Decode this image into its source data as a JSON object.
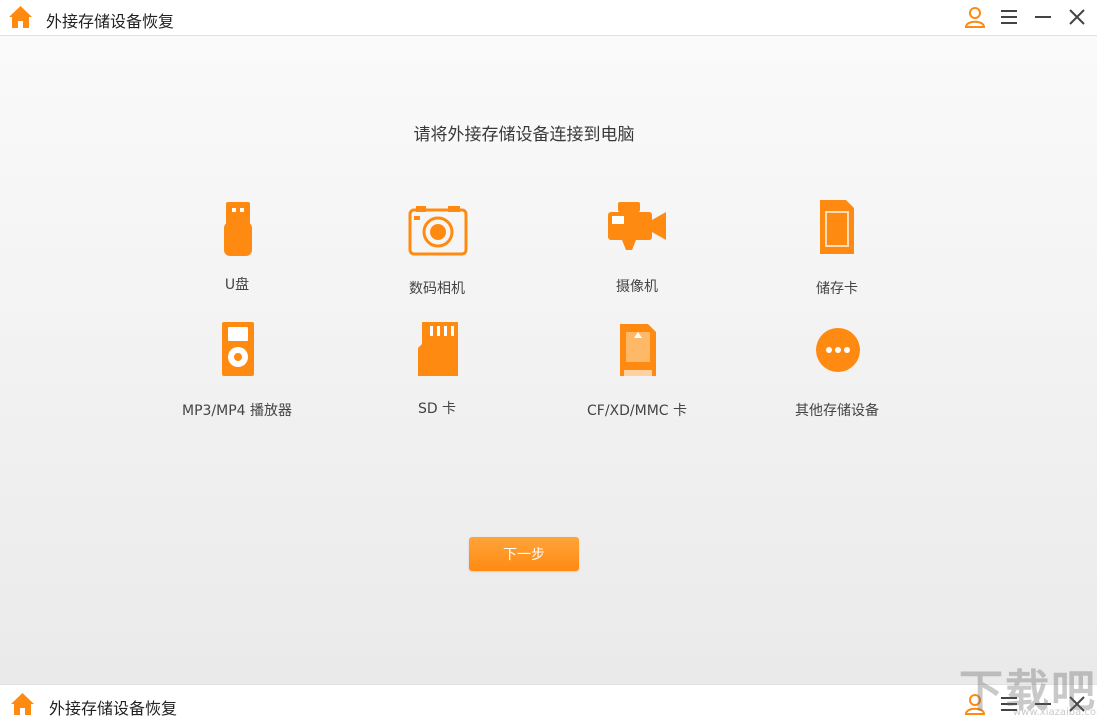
{
  "app": {
    "title": "外接存储设备恢复",
    "accent_color": "#ff8a12",
    "controls": [
      "user-icon",
      "menu-icon",
      "minimize-icon",
      "close-icon"
    ]
  },
  "main": {
    "prompt": "请将外接存储设备连接到电脑",
    "devices": [
      {
        "label": "U盘",
        "icon": "usb-drive-icon"
      },
      {
        "label": "数码相机",
        "icon": "digital-camera-icon"
      },
      {
        "label": "摄像机",
        "icon": "video-camera-icon"
      },
      {
        "label": "储存卡",
        "icon": "memory-card-icon"
      },
      {
        "label": "MP3/MP4 播放器",
        "icon": "mp3-player-icon"
      },
      {
        "label": "SD 卡",
        "icon": "sd-card-icon"
      },
      {
        "label": "CF/XD/MMC 卡",
        "icon": "cf-card-icon"
      },
      {
        "label": "其他存储设备",
        "icon": "more-icon"
      }
    ],
    "next_label": "下一步"
  },
  "footer": {
    "title": "外接存储设备恢复",
    "watermark": "下载吧",
    "watermark_url": "www.xiazaiba.com"
  }
}
